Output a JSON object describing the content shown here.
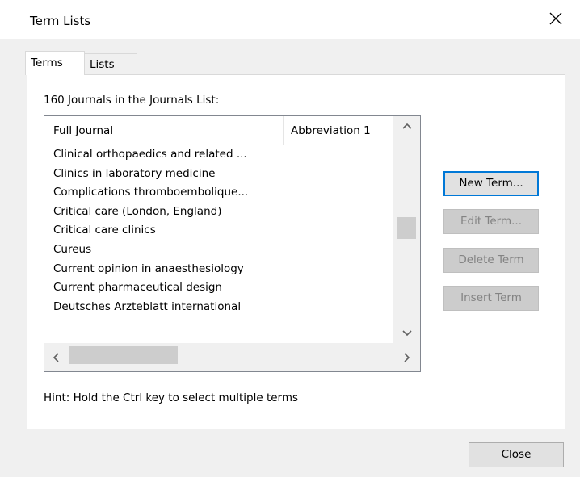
{
  "window": {
    "title": "Term Lists"
  },
  "tabs": [
    {
      "label": "Terms",
      "active": true
    },
    {
      "label": "Lists",
      "active": false
    }
  ],
  "panel": {
    "count_label": "160 Journals in the Journals List:",
    "hint": "Hint: Hold the Ctrl key to select multiple terms"
  },
  "list": {
    "columns": [
      "Full Journal",
      "Abbreviation 1"
    ],
    "rows": [
      "Clinical orthopaedics and related ...",
      "Clinics in laboratory medicine",
      "Complications thromboembolique...",
      "Critical care (London, England)",
      "Critical care clinics",
      "Cureus",
      "Current opinion in anaesthesiology",
      "Current pharmaceutical design",
      "Deutsches Arzteblatt international"
    ]
  },
  "buttons": {
    "new_term": "New Term...",
    "edit_term": "Edit Term...",
    "delete_term": "Delete Term",
    "insert_term": "Insert Term",
    "close": "Close"
  },
  "icons": {
    "close": "close-icon",
    "scroll_up": "chevron-up-icon",
    "scroll_down": "chevron-down-icon",
    "scroll_left": "chevron-left-icon",
    "scroll_right": "chevron-right-icon"
  },
  "colors": {
    "accent": "#0078d7",
    "dialog_bg": "#f0f0f0",
    "disabled_text": "#838383"
  }
}
